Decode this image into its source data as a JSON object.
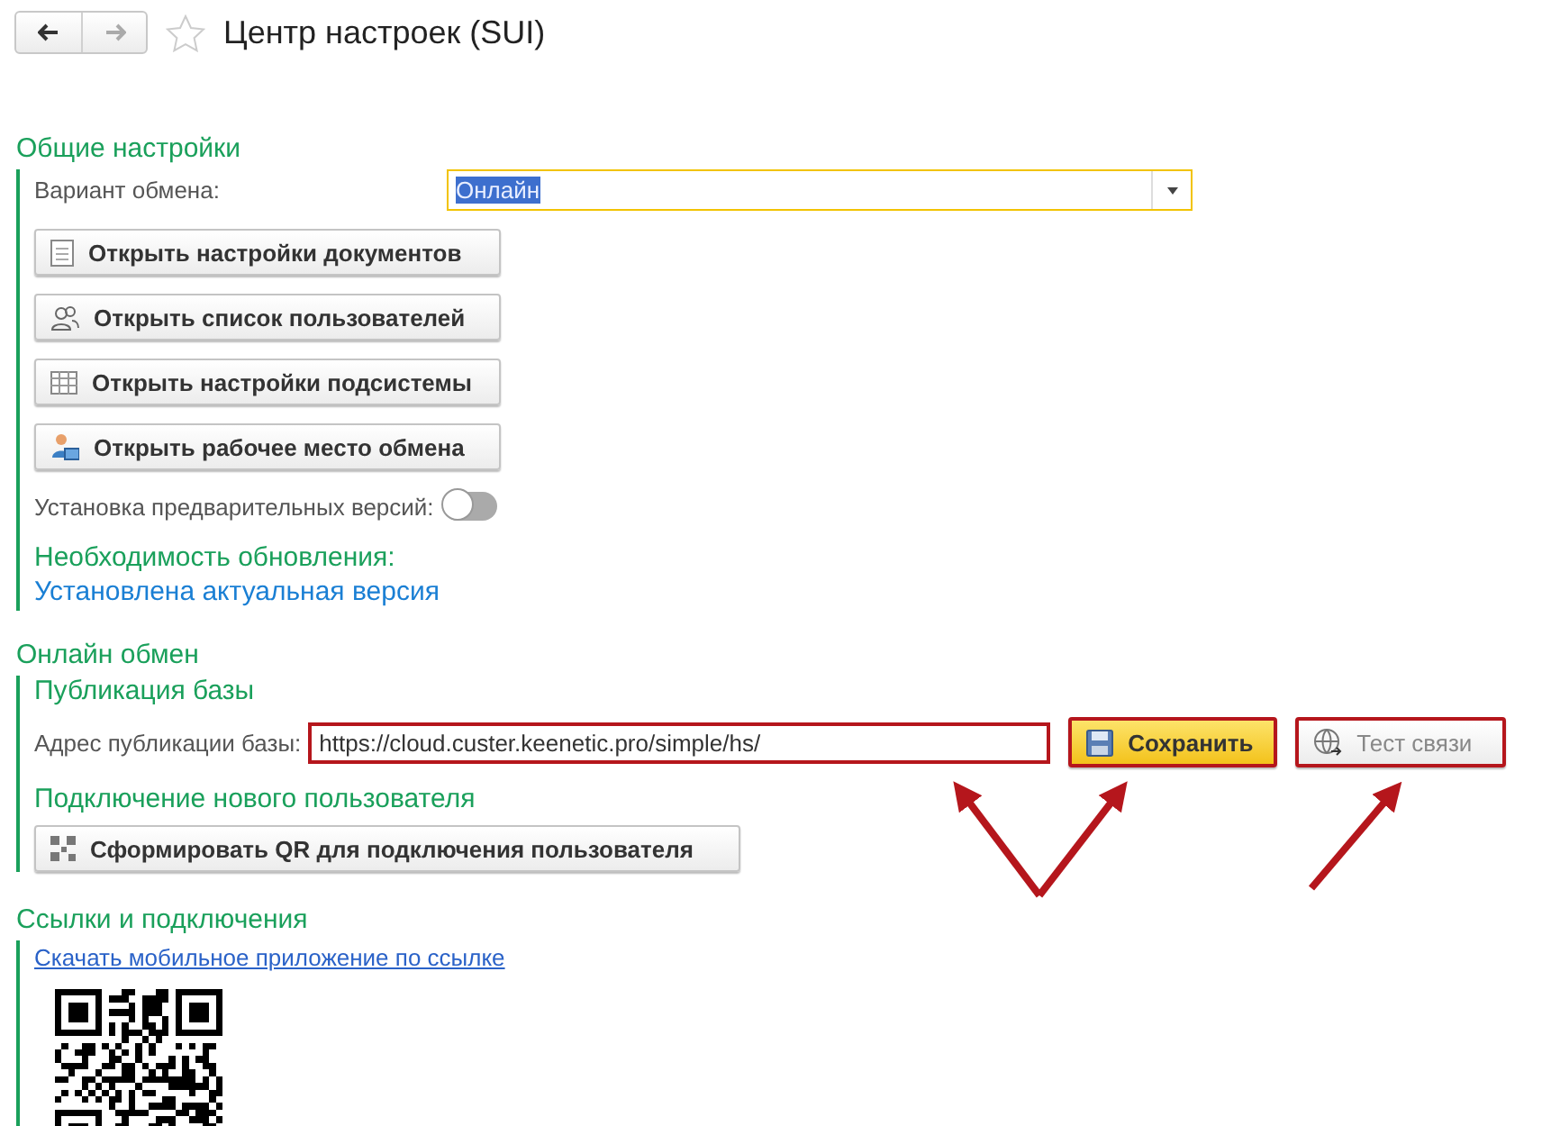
{
  "window": {
    "title": "Центр настроек (SUI)",
    "favorite": false
  },
  "general": {
    "title": "Общие настройки",
    "exchange_variant": {
      "label": "Вариант обмена:",
      "value": "Онлайн",
      "focused": true
    },
    "buttons": [
      {
        "label": "Открыть настройки документов",
        "kind": "document"
      },
      {
        "label": "Открыть список пользователей",
        "kind": "users"
      },
      {
        "label": "Открыть настройки подсистемы",
        "kind": "table"
      },
      {
        "label": "Открыть рабочее место обмена",
        "kind": "workplace"
      }
    ],
    "preview_versions": {
      "label": "Установка предварительных версий:",
      "on": false
    },
    "update_title": "Необходимость обновления:",
    "update_status": "Установлена актуальная версия"
  },
  "online": {
    "title": "Онлайн обмен",
    "publication_title": "Публикация базы",
    "address": {
      "label": "Адрес публикации базы:",
      "value": "https://cloud.custer.keenetic.pro/simple/hs/",
      "highlighted": true
    },
    "save_button": {
      "label": "Сохранить",
      "default": true,
      "highlighted": true
    },
    "test_button": {
      "label": "Тест связи",
      "disabled": true,
      "highlighted": true
    },
    "new_user_title": "Подключение нового пользователя",
    "qr_button": {
      "label": "Сформировать QR для подключения пользователя"
    }
  },
  "links": {
    "title": "Ссылки и подключения",
    "download_link": "Скачать мобильное приложение по ссылке"
  }
}
